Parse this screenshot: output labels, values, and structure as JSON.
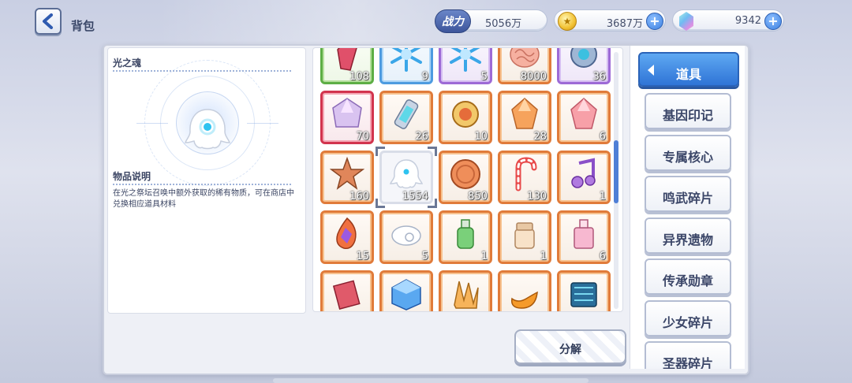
{
  "header": {
    "title": "背包",
    "power_label": "战力",
    "power_value": "5056万",
    "gold_value": "3687万",
    "gem_value": "9342"
  },
  "colors": {
    "active_tab": "#2f74d6",
    "frame_orange": "#e07b3a",
    "frame_green": "#5dae45",
    "frame_blue": "#4d9be0",
    "frame_purple": "#9d6ad6",
    "frame_red": "#d2344e"
  },
  "detail": {
    "item_name": "光之魂",
    "desc_title": "物品说明",
    "desc_text": "在光之祭坛召唤中额外获取的稀有物质，可在商店中兑换相应道具材料"
  },
  "grid": {
    "items": [
      {
        "icon": "red-crystal-icon",
        "count": "108",
        "rarity": "green"
      },
      {
        "icon": "blue-snowflake-icon",
        "count": "9",
        "rarity": "blue"
      },
      {
        "icon": "blue-snowflake-icon",
        "count": "5",
        "rarity": "purple"
      },
      {
        "icon": "brain-coral-icon",
        "count": "8000",
        "rarity": "orange"
      },
      {
        "icon": "mech-gear-icon",
        "count": "36",
        "rarity": "purple"
      },
      {
        "icon": "prism-gem-icon",
        "count": "70",
        "rarity": "red"
      },
      {
        "icon": "battery-tube-icon",
        "count": "26",
        "rarity": "orange"
      },
      {
        "icon": "golden-compass-icon",
        "count": "10",
        "rarity": "orange"
      },
      {
        "icon": "orange-gem-icon",
        "count": "28",
        "rarity": "orange"
      },
      {
        "icon": "pink-gem-icon",
        "count": "6",
        "rarity": "orange"
      },
      {
        "icon": "star-ornament-icon",
        "count": "160",
        "rarity": "orange"
      },
      {
        "icon": "light-soul-icon",
        "count": "1554",
        "rarity": "selected"
      },
      {
        "icon": "bronze-coin-icon",
        "count": "850",
        "rarity": "orange"
      },
      {
        "icon": "candy-cane-icon",
        "count": "130",
        "rarity": "orange"
      },
      {
        "icon": "music-note-icon",
        "count": "1",
        "rarity": "orange"
      },
      {
        "icon": "flame-crystal-icon",
        "count": "15",
        "rarity": "orange"
      },
      {
        "icon": "white-cloud-icon",
        "count": "5",
        "rarity": "orange"
      },
      {
        "icon": "green-bottle-icon",
        "count": "1",
        "rarity": "orange"
      },
      {
        "icon": "cream-jar-icon",
        "count": "1",
        "rarity": "orange"
      },
      {
        "icon": "pink-bottle-icon",
        "count": "6",
        "rarity": "orange"
      },
      {
        "icon": "red-scroll-icon",
        "count": "",
        "rarity": "orange"
      },
      {
        "icon": "blue-cube-icon",
        "count": "",
        "rarity": "orange"
      },
      {
        "icon": "amber-shards-icon",
        "count": "",
        "rarity": "orange"
      },
      {
        "icon": "orange-drop-icon",
        "count": "",
        "rarity": "orange"
      },
      {
        "icon": "circuit-chip-icon",
        "count": "",
        "rarity": "orange"
      }
    ]
  },
  "actions": {
    "decompose_label": "分解"
  },
  "tabs": [
    {
      "label": "道具",
      "active": true
    },
    {
      "label": "基因印记"
    },
    {
      "label": "专属核心"
    },
    {
      "label": "鸣武碎片"
    },
    {
      "label": "异界遗物"
    },
    {
      "label": "传承勋章"
    },
    {
      "label": "少女碎片"
    },
    {
      "label": "圣器碎片"
    }
  ]
}
